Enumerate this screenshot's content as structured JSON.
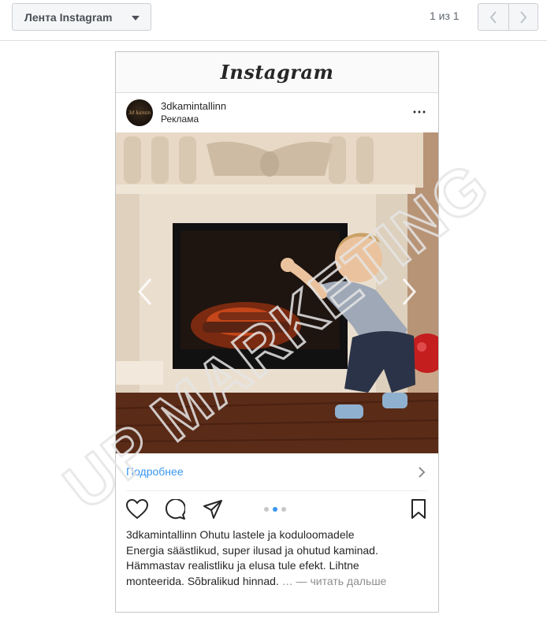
{
  "toolbar": {
    "feed_label": "Лента Instagram",
    "pager_text": "1 из 1"
  },
  "card": {
    "logo_text": "Instagram",
    "account_name": "3dkamintallinn",
    "sponsored_label": "Реклама",
    "avatar_text": "3d kamin",
    "more_icon": "⋯",
    "cta_label": "Подробнее",
    "carousel": {
      "total_slides": 3,
      "active_slide": 2
    },
    "caption_title": "3dkamintallinn Ohutu lastele ja koduloomadele",
    "caption_lines": [
      "Energia säästlikud, super ilusad ja ohutud kaminad.",
      "Hämmastav realistliku ja elusa tule efekt. Lihtne",
      "monteerida. Sõbralikud hinnad. "
    ],
    "read_more": "… — читать дальше"
  },
  "watermark_text": "UP MARKETING",
  "colors": {
    "link": "#3897f0",
    "border": "#dddfe2",
    "text": "#262626",
    "muted": "#8e8e8e"
  }
}
